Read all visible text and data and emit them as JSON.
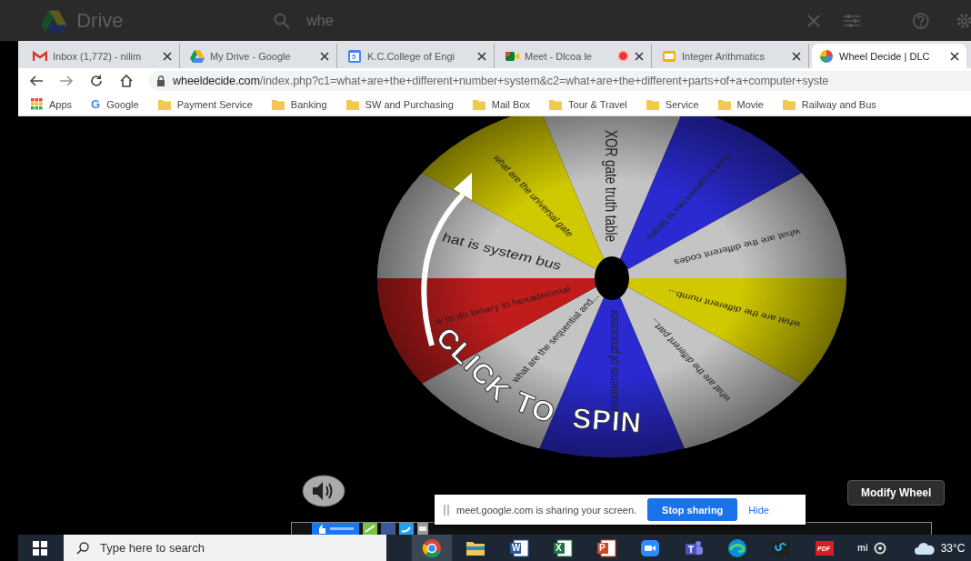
{
  "drive_bar": {
    "title": "Drive",
    "search_value": "whe"
  },
  "tabs": [
    {
      "title": "Inbox (1,772) - nilim",
      "kind": "gmail",
      "recording": false,
      "selected": false
    },
    {
      "title": "My Drive - Google",
      "kind": "drive",
      "recording": false,
      "selected": false
    },
    {
      "title": "K.C.College of Engi",
      "kind": "calendar",
      "glyph": "5",
      "recording": false,
      "selected": false
    },
    {
      "title": "Meet - Dlcoa le",
      "kind": "meet",
      "recording": true,
      "selected": false
    },
    {
      "title": "Integer Arithmatics",
      "kind": "slides",
      "recording": false,
      "selected": false
    },
    {
      "title": "Wheel Decide | DLC",
      "kind": "wheel",
      "recording": false,
      "selected": true
    }
  ],
  "address_bar": {
    "domain": "wheeldecide.com",
    "path": "/index.php?c1=what+are+the+different+number+system&c2=what+are+the+different+parts+of+a+computer+syste"
  },
  "bookmarks": [
    {
      "label": "Apps",
      "kind": "apps"
    },
    {
      "label": "Google",
      "kind": "google",
      "glyph": "G"
    },
    {
      "label": "Payment Service",
      "kind": "folder"
    },
    {
      "label": "Banking",
      "kind": "folder"
    },
    {
      "label": "SW and Purchasing",
      "kind": "folder"
    },
    {
      "label": "Mail Box",
      "kind": "folder"
    },
    {
      "label": "Tour & Travel",
      "kind": "folder"
    },
    {
      "label": "Service",
      "kind": "folder"
    },
    {
      "label": "Movie",
      "kind": "folder"
    },
    {
      "label": "Railway and Bus",
      "kind": "folder"
    }
  ],
  "wheel": {
    "prompt": "CLICK TO SPIN",
    "segments": [
      {
        "label": "XOR gate truth table",
        "color": "#c4c4c4",
        "large": true
      },
      {
        "label": "how to convert hex to binary",
        "color": "#2a2ad0",
        "large": false
      },
      {
        "label": "what are the different codes",
        "color": "#c4c4c4",
        "large": false
      },
      {
        "label": "what are the different numb...",
        "color": "#d0c800",
        "large": false
      },
      {
        "label": "what are the different part...",
        "color": "#c4c4c4",
        "large": false
      },
      {
        "label": "mponents of processor",
        "color": "#2a2ad0",
        "large": true
      },
      {
        "label": "what are the sequential and...",
        "color": "#c4c4c4",
        "large": false
      },
      {
        "label": "w to do binary to hexadecimal",
        "color": "#c01c1c",
        "large": false
      },
      {
        "label": "hat is system bus",
        "color": "#c4c4c4",
        "large": true
      },
      {
        "label": "what are the  universal gate",
        "color": "#d0c800",
        "large": false
      }
    ]
  },
  "modify_button": "Modify Wheel",
  "share_notice": {
    "text": "meet.google.com is sharing your screen.",
    "stop": "Stop sharing",
    "hide": "Hide"
  },
  "taskbar": {
    "search_placeholder": "Type here to search",
    "apps": [
      {
        "kind": "chrome",
        "selected": true
      },
      {
        "kind": "explorer",
        "selected": false
      },
      {
        "kind": "word",
        "glyph": "W",
        "selected": false
      },
      {
        "kind": "excel",
        "glyph": "X",
        "selected": false
      },
      {
        "kind": "powerpoint",
        "glyph": "P",
        "selected": false
      },
      {
        "kind": "zoom",
        "selected": false
      },
      {
        "kind": "teams",
        "selected": false
      },
      {
        "kind": "edge",
        "selected": false
      },
      {
        "kind": "loop",
        "selected": false
      },
      {
        "kind": "pdf",
        "glyph": "PDF",
        "selected": false
      }
    ],
    "tray_label": "mi",
    "temperature": "33°C"
  }
}
